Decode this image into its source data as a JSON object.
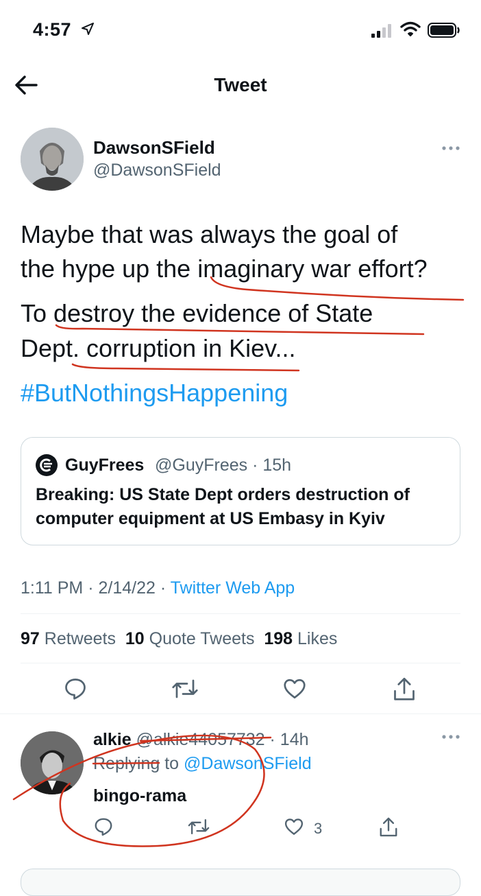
{
  "status_bar": {
    "time": "4:57"
  },
  "header": {
    "title": "Tweet"
  },
  "tweet": {
    "author_name": "DawsonSField",
    "author_handle": "@DawsonSField",
    "text_lines": [
      "Maybe that was always the goal of",
      "the hype up the imaginary war effort?",
      "To destroy the evidence of State",
      "Dept. corruption in Kiev..."
    ],
    "hashtag": "#ButNothingsHappening",
    "timestamp": "1:11 PM · 2/14/22 · ",
    "source": "Twitter Web App",
    "stats": {
      "retweets_count": "97",
      "retweets_label": "Retweets",
      "quotes_count": "10",
      "quotes_label": "Quote Tweets",
      "likes_count": "198",
      "likes_label": "Likes"
    }
  },
  "quoted_tweet": {
    "name": "GuyFrees",
    "handle_time": "@GuyFrees · 15h",
    "text_lines": [
      "Breaking: US State Dept orders destruction of",
      "computer equipment at US Embasy in Kyiv"
    ]
  },
  "reply": {
    "name": "alkie",
    "handle_time": "@alkie44057732 · 14h",
    "replying_prefix": "Replying to ",
    "replying_handle": "@DawsonSField",
    "text": "bingo-rama",
    "like_count": "3"
  },
  "colors": {
    "accent": "#1d9bf0",
    "secondary_text": "#536471",
    "annotation": "#d0341f"
  },
  "icons": [
    "back-arrow-icon",
    "more-icon",
    "reply-icon",
    "retweet-icon",
    "like-icon",
    "share-icon",
    "location-arrow-icon",
    "signal-icon",
    "wifi-icon",
    "battery-icon"
  ]
}
